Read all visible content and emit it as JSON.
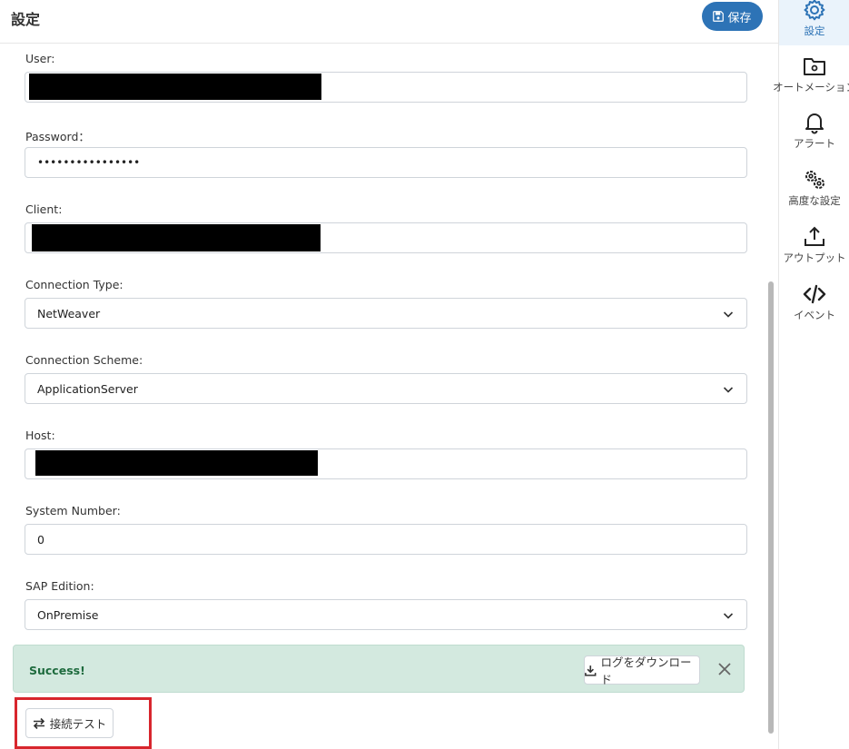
{
  "header": {
    "title": "設定",
    "save_label": "保存"
  },
  "form": {
    "user": {
      "label": "User:",
      "value": ""
    },
    "password": {
      "label": "Password：",
      "value": "••••••••••••••••"
    },
    "client": {
      "label": "Client:",
      "value": ""
    },
    "connection_type": {
      "label": "Connection Type:",
      "value": "NetWeaver"
    },
    "connection_scheme": {
      "label": "Connection Scheme:",
      "value": "ApplicationServer"
    },
    "host": {
      "label": "Host:",
      "value": ""
    },
    "system_number": {
      "label": "System Number:",
      "value": "0"
    },
    "sap_edition": {
      "label": "SAP Edition:",
      "value": "OnPremise"
    }
  },
  "alert": {
    "message": "Success!",
    "download_label": "ログをダウンロード"
  },
  "test_button_label": "接続テスト",
  "sidebar": {
    "items": [
      {
        "label": "設定",
        "icon": "gear-icon",
        "active": true
      },
      {
        "label": "オートメーション",
        "icon": "folder-gear-icon",
        "active": false
      },
      {
        "label": "アラート",
        "icon": "bell-icon",
        "active": false
      },
      {
        "label": "高度な設定",
        "icon": "gears-icon",
        "active": false
      },
      {
        "label": "アウトプット",
        "icon": "upload-icon",
        "active": false
      },
      {
        "label": "イベント",
        "icon": "code-icon",
        "active": false
      }
    ]
  },
  "colors": {
    "accent": "#2d73b6",
    "success_bg": "#d3e9df",
    "success_text": "#1e6b3e",
    "highlight": "#d8262d"
  }
}
